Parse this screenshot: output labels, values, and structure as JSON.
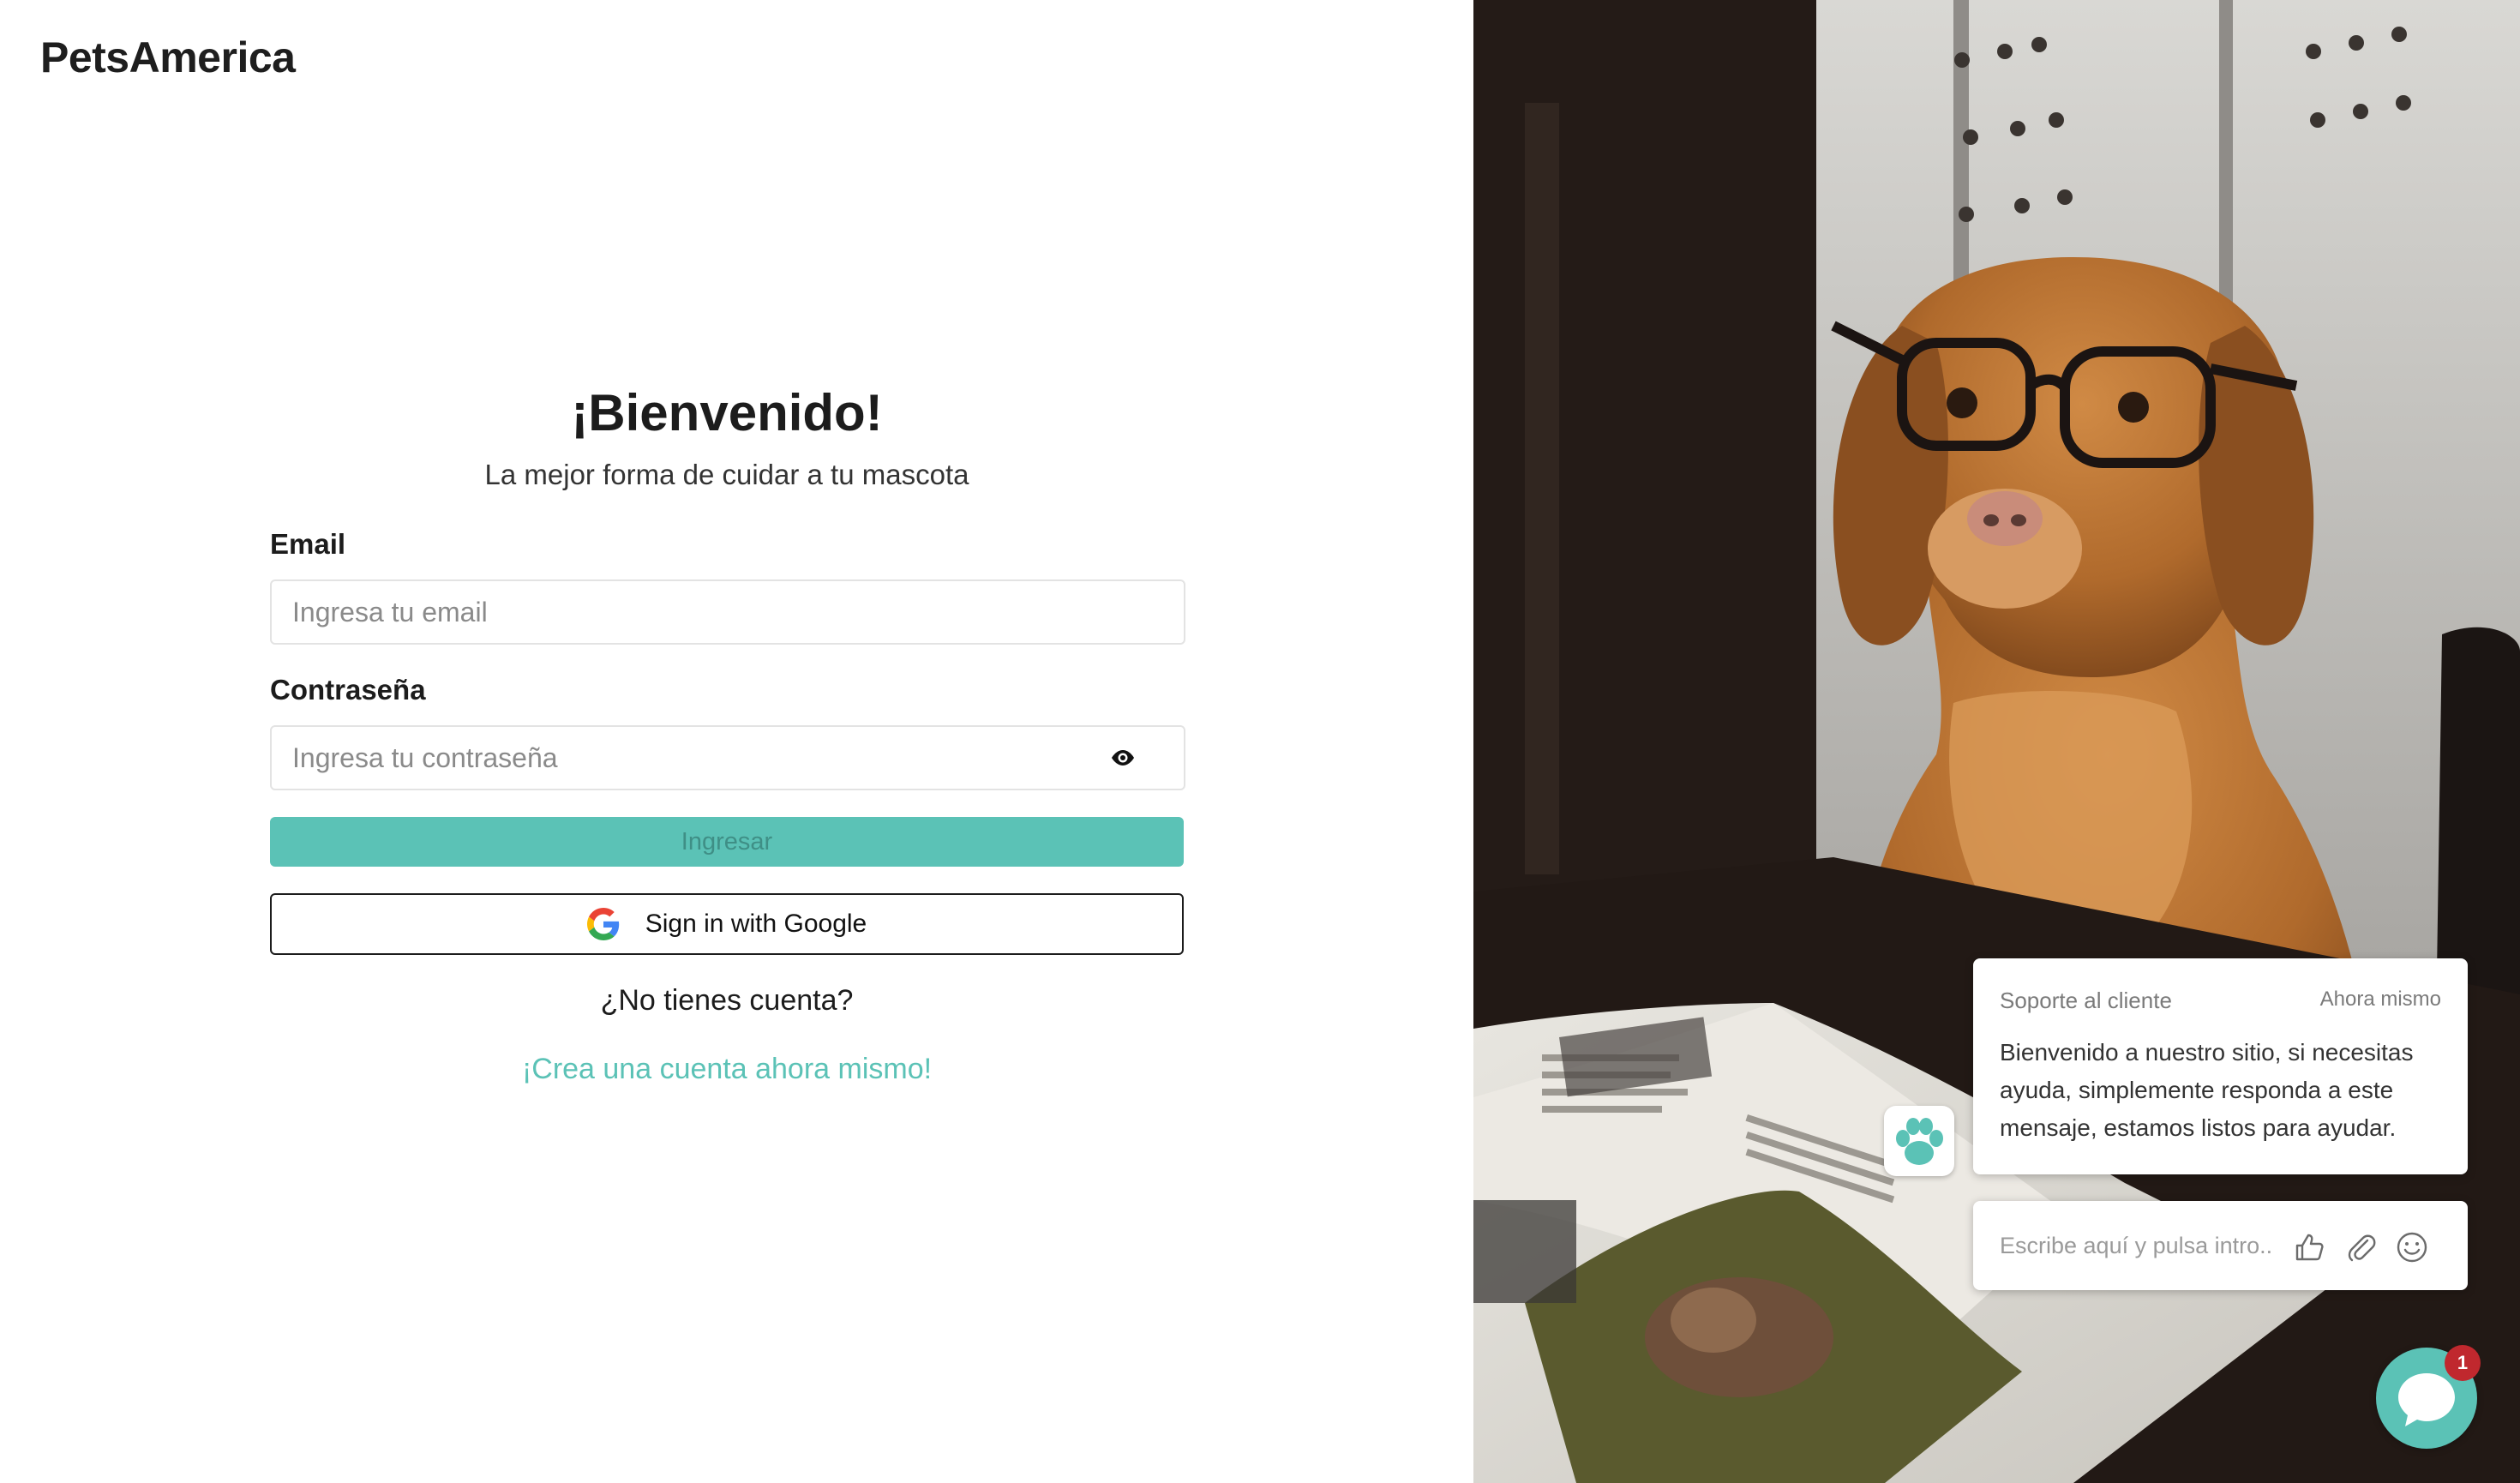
{
  "brand": {
    "name": "PetsAmerica"
  },
  "login": {
    "title": "¡Bienvenido!",
    "subtitle": "La mejor forma de cuidar a tu mascota",
    "email_label": "Email",
    "email_placeholder": "Ingresa tu email",
    "email_value": "",
    "password_label": "Contraseña",
    "password_placeholder": "Ingresa tu contraseña",
    "password_value": "",
    "submit_label": "Ingresar",
    "google_label": "Sign in with Google",
    "no_account_text": "¿No tienes cuenta?",
    "create_account_link": "¡Crea una cuenta ahora mismo!"
  },
  "chat": {
    "agent_name": "Soporte al cliente",
    "timestamp": "Ahora mismo",
    "message": "Bienvenido a nuestro sitio, si necesitas ayuda, simplemente responda a este mensaje, estamos listos para ayudar.",
    "input_placeholder": "Escribe aquí y pulsa intro..",
    "unread_count": "1",
    "icons": [
      "paw-icon",
      "thumbs-up-icon",
      "paperclip-icon",
      "smiley-icon",
      "chat-bubble-icon"
    ]
  },
  "icons": {
    "password_toggle": "eye-icon",
    "google": "google-g-icon"
  },
  "colors": {
    "accent": "#5bc2b6",
    "badge": "#c0282e",
    "text": "#1c1c1c"
  }
}
